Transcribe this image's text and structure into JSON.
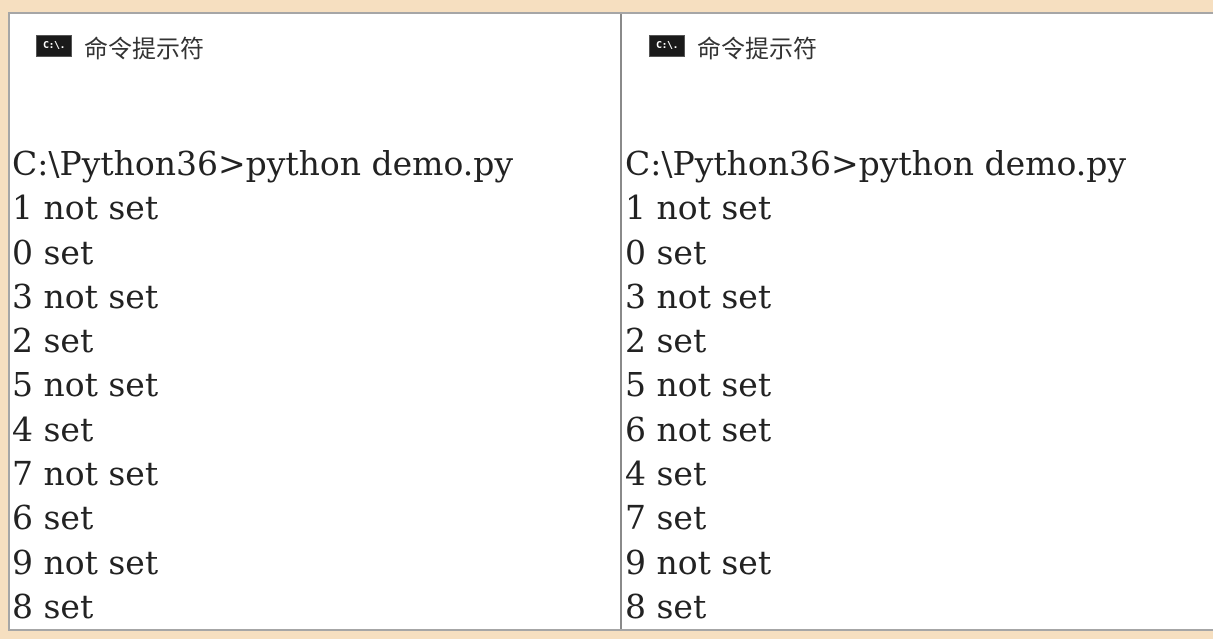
{
  "panes": [
    {
      "title": "命令提示符",
      "icon": {
        "name": "cmd-icon",
        "text": "C:\\."
      },
      "lines": [
        "C:\\Python36>python demo.py",
        "1 not set",
        "0 set",
        "3 not set",
        "2 set",
        "5 not set",
        "4 set",
        "7 not set",
        "6 set",
        "9 not set",
        "8 set"
      ]
    },
    {
      "title": "命令提示符",
      "icon": {
        "name": "cmd-icon",
        "text": "C:\\."
      },
      "lines": [
        "C:\\Python36>python demo.py",
        "1 not set",
        "0 set",
        "3 not set",
        "2 set",
        "5 not set",
        "6 not set",
        "4 set",
        "7 set",
        "9 not set",
        "8 set"
      ]
    }
  ],
  "colors": {
    "page_background": "#f6dfc0",
    "console_background": "#ffffff",
    "text": "#222222",
    "divider": "#8a8a8a"
  }
}
